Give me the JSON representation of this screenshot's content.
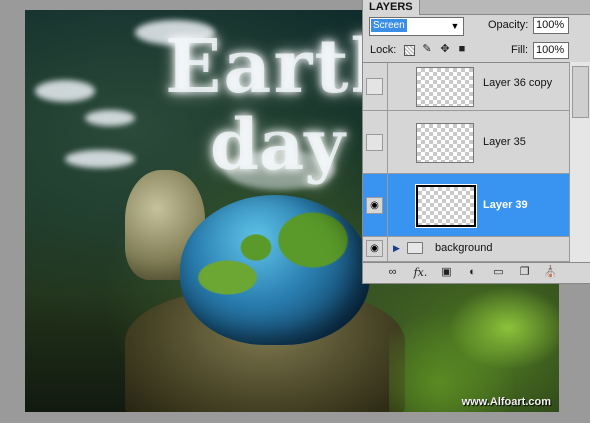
{
  "canvas": {
    "title_word_1": "Earth",
    "title_word_2": "day",
    "watermark": "www.Alfoart.com"
  },
  "layers_panel": {
    "tab_label": "LAYERS",
    "blend_mode": "Screen",
    "opacity_label": "Opacity:",
    "opacity_value": "100%",
    "lock_label": "Lock:",
    "fill_label": "Fill:",
    "fill_value": "100%",
    "layers": [
      {
        "name": "Layer 36 copy",
        "visible": false,
        "selected": false
      },
      {
        "name": "Layer 35",
        "visible": false,
        "selected": false
      },
      {
        "name": "Layer 39",
        "visible": true,
        "selected": true
      },
      {
        "name": "background",
        "visible": true,
        "selected": false,
        "is_group": true
      }
    ],
    "bottom_icons": [
      "link-icon",
      "fx-icon",
      "mask-icon",
      "adjustment-icon",
      "folder-icon",
      "new-layer-icon",
      "trash-icon"
    ],
    "selected_color": "#3894f0"
  }
}
